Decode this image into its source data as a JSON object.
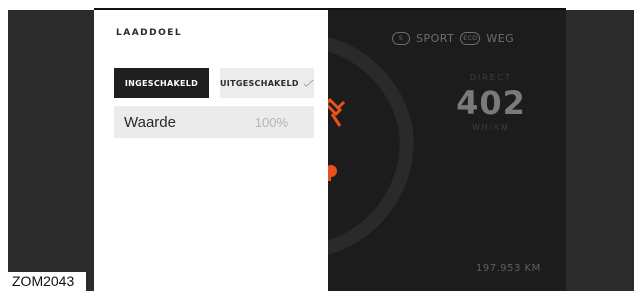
{
  "panel": {
    "title": "LAADDOEL",
    "toggle_on_label": "INGESCHAKELD",
    "toggle_off_label": "UITGESCHAKELD",
    "value_label": "Waarde",
    "value": "100%"
  },
  "dashboard": {
    "mode_sport": "SPORT",
    "mode_road": "WEG",
    "sport_icon_text": "S",
    "road_icon_text": "ECO",
    "direct_label": "DIRECT",
    "direct_value": "402",
    "direct_unit": "WH/KM",
    "odometer": "197.953 KM",
    "accent_color": "#e8521c"
  },
  "figure": {
    "caption": "ZOM2043"
  }
}
